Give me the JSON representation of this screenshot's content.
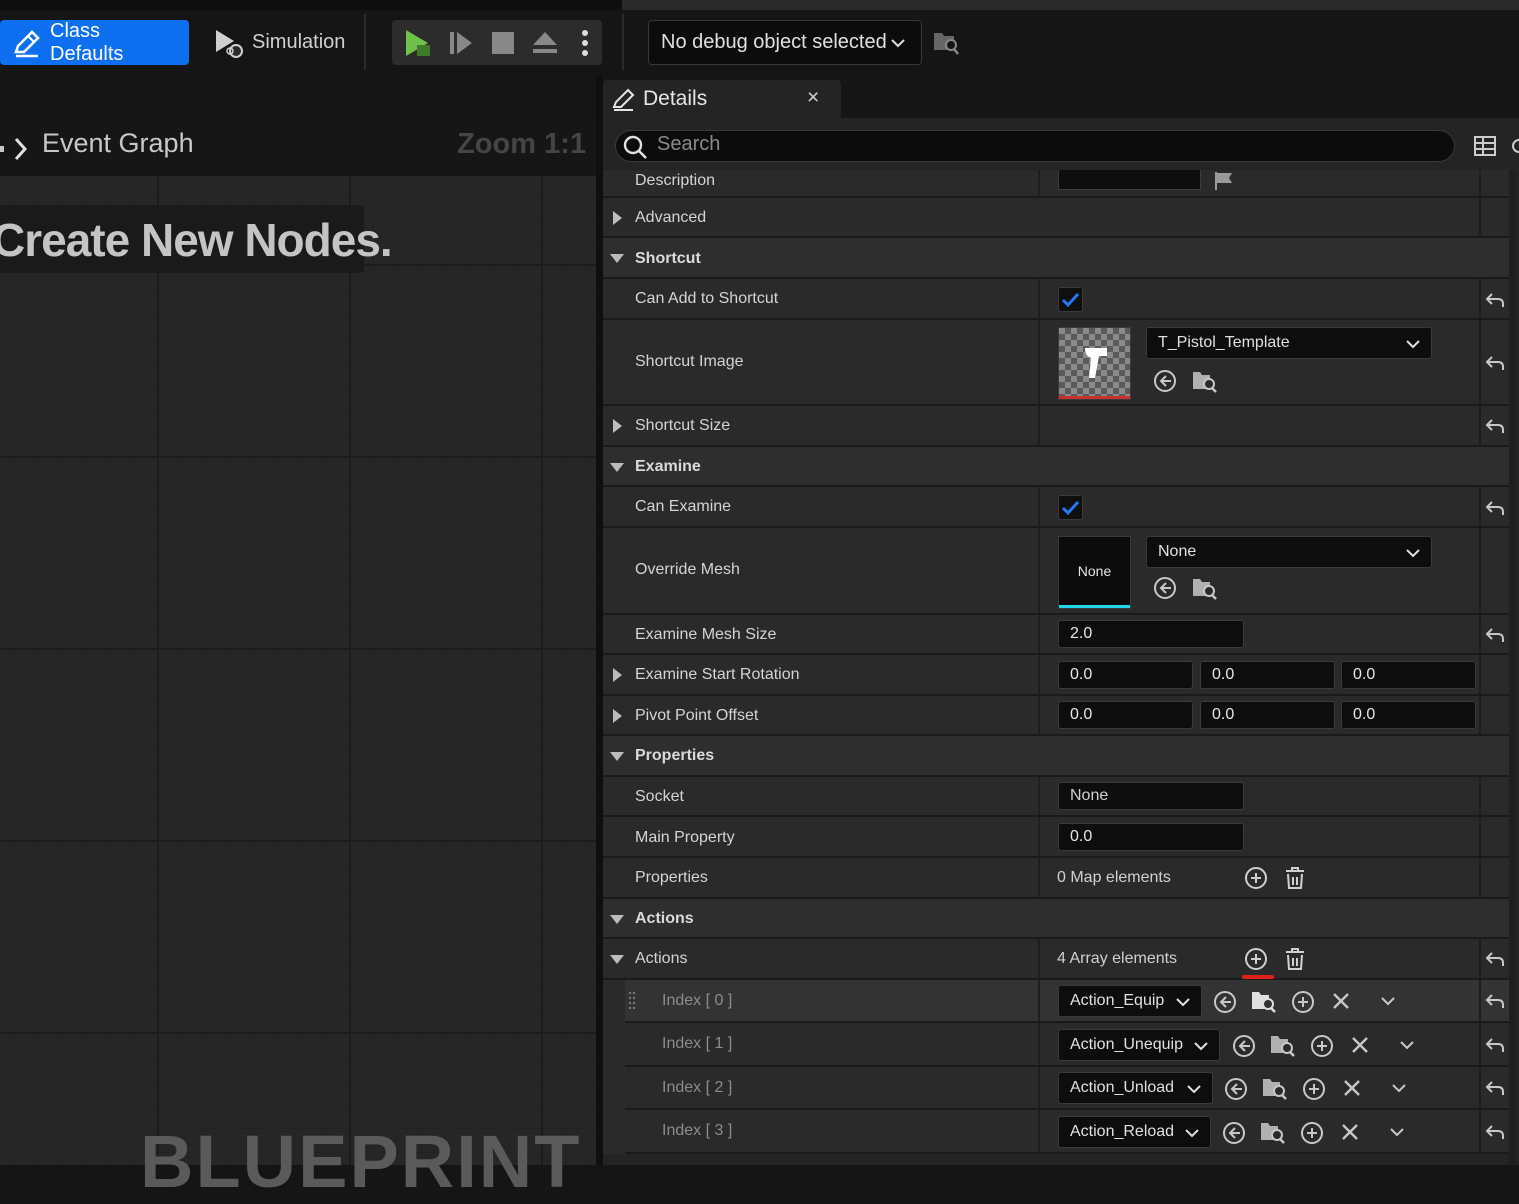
{
  "toolbar": {
    "class_defaults_label": "Class Defaults",
    "simulation_label": "Simulation",
    "debug_select_value": "No debug object selected"
  },
  "graph": {
    "breadcrumb_label": "Event Graph",
    "zoom_label": "Zoom 1:1",
    "hint_text": "Create New Nodes.",
    "watermark": "BLUEPRINT"
  },
  "details": {
    "tab_label": "Details",
    "close_glyph": "×",
    "search_placeholder": "Search",
    "description_label": "Description",
    "advanced_label": "Advanced",
    "shortcut": {
      "category_label": "Shortcut",
      "can_add_label": "Can Add to Shortcut",
      "can_add_checked": true,
      "image_label": "Shortcut Image",
      "image_value": "T_Pistol_Template",
      "size_label": "Shortcut Size"
    },
    "examine": {
      "category_label": "Examine",
      "can_examine_label": "Can Examine",
      "can_examine_checked": true,
      "override_mesh_label": "Override Mesh",
      "override_mesh_thumb": "None",
      "override_mesh_value": "None",
      "mesh_size_label": "Examine Mesh Size",
      "mesh_size_value": "2.0",
      "start_rotation_label": "Examine Start Rotation",
      "start_rotation": [
        "0.0",
        "0.0",
        "0.0"
      ],
      "pivot_label": "Pivot Point Offset",
      "pivot": [
        "0.0",
        "0.0",
        "0.0"
      ]
    },
    "properties": {
      "category_label": "Properties",
      "socket_label": "Socket",
      "socket_value": "None",
      "main_property_label": "Main Property",
      "main_property_value": "0.0",
      "properties_label": "Properties",
      "properties_value": "0 Map elements"
    },
    "actions": {
      "category_label": "Actions",
      "actions_label": "Actions",
      "actions_value": "4 Array elements",
      "items": [
        {
          "index": "Index [ 0 ]",
          "value": "Action_Equip"
        },
        {
          "index": "Index [ 1 ]",
          "value": "Action_Unequip"
        },
        {
          "index": "Index [ 2 ]",
          "value": "Action_Unload"
        },
        {
          "index": "Index [ 3 ]",
          "value": "Action_Reload"
        }
      ]
    }
  },
  "colors": {
    "accent": "#0e70f0",
    "play_green": "#6ec24a",
    "highlight_red": "#e0201a",
    "mesh_cyan": "#22d8e8"
  }
}
